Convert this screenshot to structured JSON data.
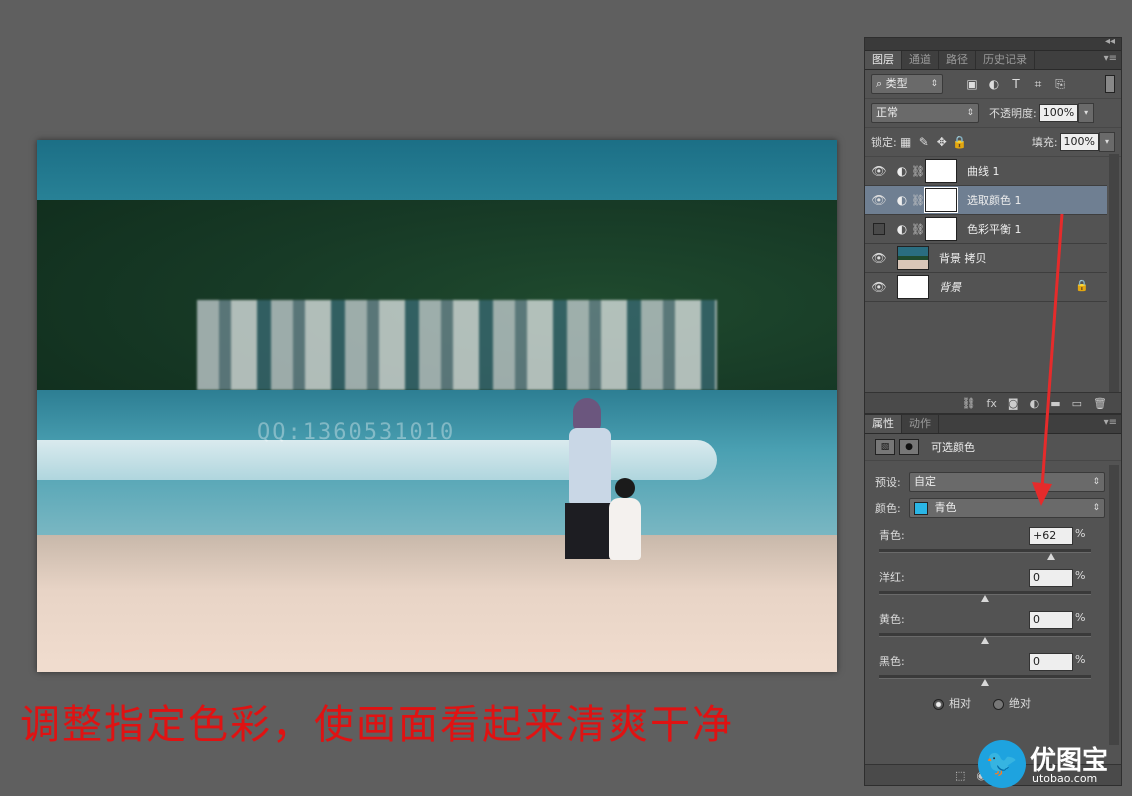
{
  "layers_panel": {
    "collapse_glyph": "◂◂",
    "tabs": [
      "图层",
      "通道",
      "路径",
      "历史记录"
    ],
    "menu_glyph": "▾≡",
    "filter": {
      "search_glyph": "⌕",
      "label": "类型"
    },
    "filter_icons": [
      "▣",
      "◐",
      "T",
      "⌗",
      "⎘"
    ],
    "blend_mode": "正常",
    "opacity_label": "不透明度:",
    "opacity_value": "100%",
    "lock_label": "锁定:",
    "lock_icons": [
      "▦",
      "✎",
      "✥",
      "🔒"
    ],
    "fill_label": "填充:",
    "fill_value": "100%",
    "layers": [
      {
        "name": "曲线 1",
        "visible": true,
        "adjustment": true
      },
      {
        "name": "选取颜色 1",
        "visible": true,
        "adjustment": true,
        "selected": true
      },
      {
        "name": "色彩平衡 1",
        "visible": false,
        "adjustment": true
      },
      {
        "name": "背景 拷贝",
        "visible": true,
        "adjustment": false
      },
      {
        "name": "背景",
        "visible": true,
        "adjustment": false,
        "locked": true
      }
    ],
    "bottom_icons": [
      "⛓",
      "fx",
      "◙",
      "◐",
      "▬",
      "▭",
      "🗑"
    ]
  },
  "properties_panel": {
    "tabs": [
      "属性",
      "动作"
    ],
    "menu_glyph": "▾≡",
    "title": "可选颜色",
    "preset_label": "预设:",
    "preset_value": "自定",
    "color_label": "颜色:",
    "color_value": "青色",
    "color_swatch": "#2ab6e6",
    "sliders": [
      {
        "label": "青色:",
        "value": "+62",
        "fraction": 0.81
      },
      {
        "label": "洋红:",
        "value": "0",
        "fraction": 0.5
      },
      {
        "label": "黄色:",
        "value": "0",
        "fraction": 0.5
      },
      {
        "label": "黑色:",
        "value": "0",
        "fraction": 0.5
      }
    ],
    "percent": "%",
    "method_relative": "相对",
    "method_absolute": "绝对",
    "method_selected": "relative",
    "bottom_icons": [
      "⬚",
      "◉"
    ]
  },
  "photo_watermark": "QQ:1360531010",
  "caption": "调整指定色彩，使画面看起来清爽干净",
  "logo": {
    "name": "优图宝",
    "url": "utobao.com"
  },
  "colors": {
    "annotation_arrow": "#e52b2b",
    "caption": "#e01212",
    "selected_layer": "#6f7f92"
  }
}
